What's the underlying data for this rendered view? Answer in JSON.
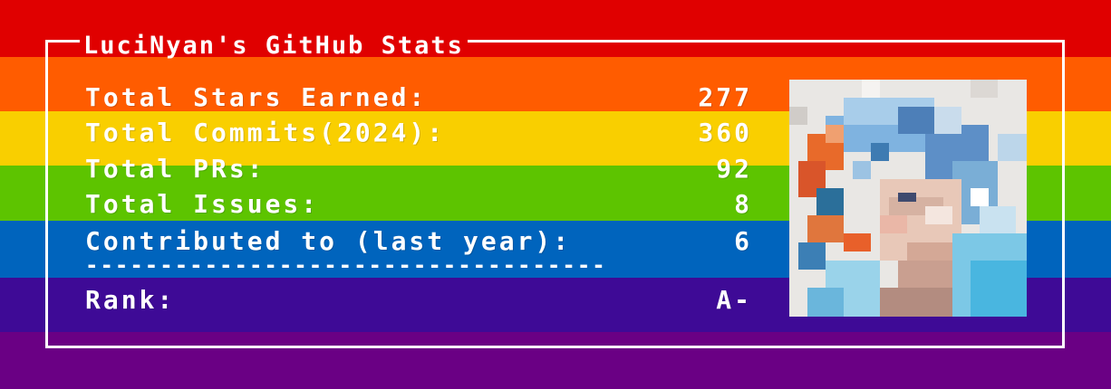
{
  "card": {
    "title": "LuciNyan's GitHub Stats",
    "stats": [
      {
        "label": "Total Stars Earned:",
        "value": "277"
      },
      {
        "label": "Total Commits(2024):",
        "value": "360"
      },
      {
        "label": "Total PRs:",
        "value": "92"
      },
      {
        "label": "Total Issues:",
        "value": "8"
      },
      {
        "label": "Contributed to (last year):",
        "value": "6"
      }
    ],
    "divider": "-----------------------------------",
    "rank_label": "Rank:",
    "rank_value": "A-"
  },
  "colors": {
    "rainbow": [
      "#e00000",
      "#ff5c00",
      "#f9cf00",
      "#5dc400",
      "#0064bd",
      "#3e0a96",
      "#6a0084"
    ],
    "text": "#ffffff",
    "frame": "#ffffff"
  },
  "avatar": {
    "icon": "pixelated-anime-girl-avatar"
  }
}
